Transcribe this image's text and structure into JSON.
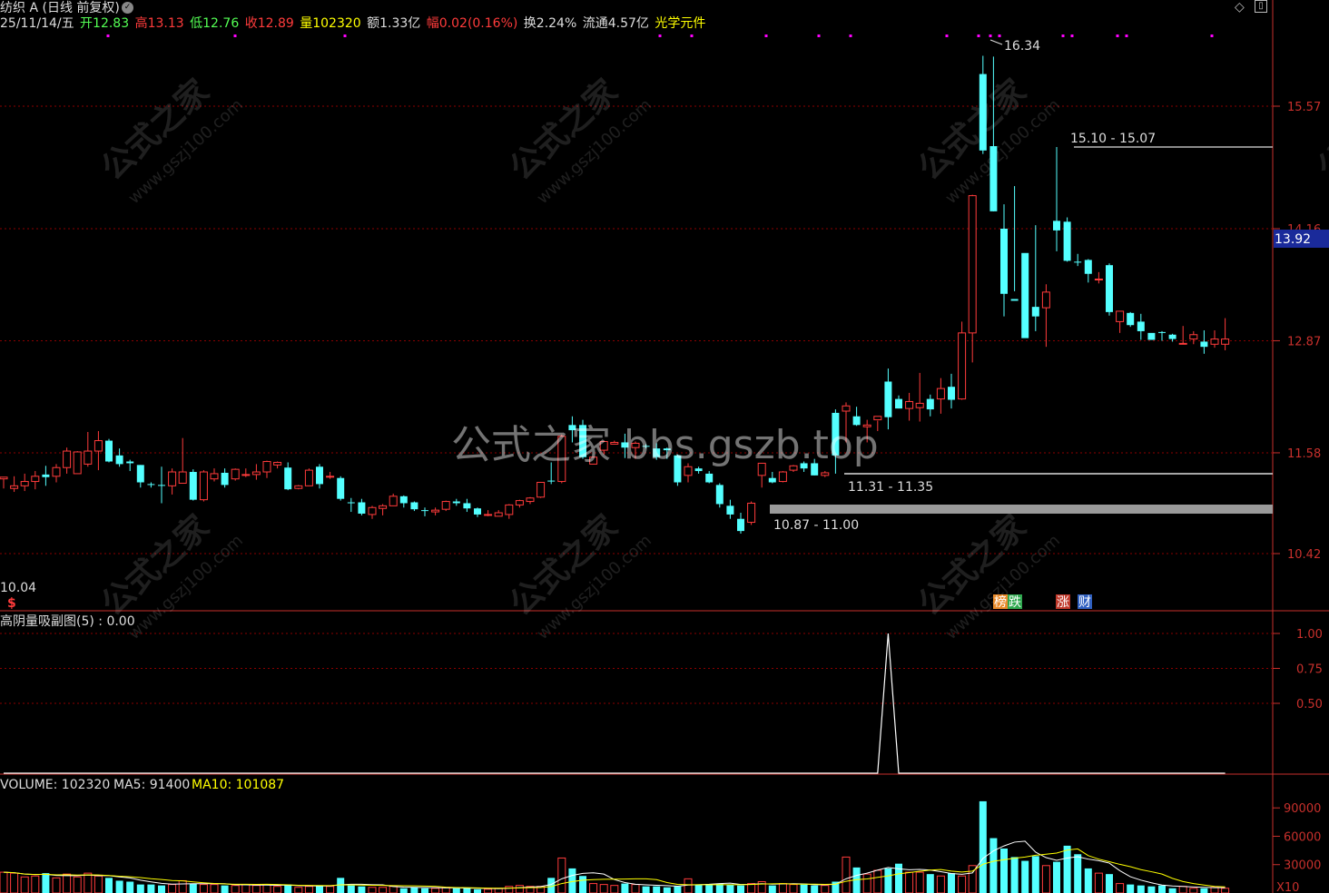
{
  "header": {
    "title": "纺织 A (日线 前复权)",
    "date": "25/11/14/五",
    "open_label": "开",
    "open": "12.83",
    "high_label": "高",
    "high": "13.13",
    "low_label": "低",
    "low": "12.76",
    "close_label": "收",
    "close": "12.89",
    "vol_label": "量",
    "vol": "102320",
    "amount": "额1.33亿",
    "change_label": "幅",
    "change": "0.02(0.16%)",
    "turnover": "换2.24%",
    "float_cap": "流通4.57亿",
    "concept": "光学元件"
  },
  "watermark": {
    "main": "公式之家 bbs.gszb.top",
    "tile_cn": "公式之家",
    "tile_url": "www.gszj100.com"
  },
  "colors": {
    "up": "#ff3b3b",
    "down": "#54ffff",
    "grid": "#8b0000",
    "axis": "#c8302c",
    "white": "#ffffff",
    "yellow": "#ffff00",
    "magenta": "#ff00ff"
  },
  "chart_data": [
    {
      "type": "candlestick",
      "name": "main",
      "price_axis_ticks": [
        "15.57",
        "14.16",
        "12.87",
        "11.58",
        "10.42"
      ],
      "current_price_tag": "13.92",
      "low_label": "10.04",
      "peak_label": "16.34",
      "annotations": [
        {
          "text": "15.10 - 15.07"
        },
        {
          "text": "11.31 - 11.35"
        },
        {
          "text": "10.87 - 11.00"
        }
      ],
      "badges": [
        {
          "text": "榜",
          "color": "#e88a2a"
        },
        {
          "text": "跌",
          "color": "#2fa84f"
        },
        {
          "text": "涨",
          "color": "#c0392b"
        },
        {
          "text": "财",
          "color": "#3060c0"
        }
      ],
      "marker": "$",
      "signal_dots": 19,
      "ohlc": [
        [
          11.28,
          11.3,
          11.17,
          11.3
        ],
        [
          11.17,
          11.31,
          11.13,
          11.2
        ],
        [
          11.2,
          11.34,
          11.14,
          11.25
        ],
        [
          11.25,
          11.37,
          11.16,
          11.31
        ],
        [
          11.33,
          11.43,
          11.2,
          11.3
        ],
        [
          11.31,
          11.45,
          11.24,
          11.41
        ],
        [
          11.41,
          11.64,
          11.34,
          11.6
        ],
        [
          11.34,
          11.6,
          11.34,
          11.59
        ],
        [
          11.45,
          11.82,
          11.42,
          11.6
        ],
        [
          11.6,
          11.83,
          11.38,
          11.72
        ],
        [
          11.72,
          11.74,
          11.47,
          11.48
        ],
        [
          11.55,
          11.63,
          11.42,
          11.45
        ],
        [
          11.48,
          11.5,
          11.37,
          11.46
        ],
        [
          11.44,
          11.44,
          11.18,
          11.24
        ],
        [
          11.22,
          11.24,
          11.18,
          11.21
        ],
        [
          11.21,
          11.42,
          11.0,
          11.2
        ],
        [
          11.2,
          11.4,
          11.1,
          11.36
        ],
        [
          11.23,
          11.75,
          11.25,
          11.36
        ],
        [
          11.36,
          11.39,
          11.03,
          11.04
        ],
        [
          11.04,
          11.38,
          11.02,
          11.36
        ],
        [
          11.28,
          11.4,
          11.25,
          11.34
        ],
        [
          11.35,
          11.4,
          11.18,
          11.21
        ],
        [
          11.28,
          11.4,
          11.26,
          11.39
        ],
        [
          11.32,
          11.4,
          11.3,
          11.33
        ],
        [
          11.33,
          11.45,
          11.27,
          11.36
        ],
        [
          11.36,
          11.49,
          11.29,
          11.48
        ],
        [
          11.44,
          11.48,
          11.4,
          11.47
        ],
        [
          11.41,
          11.47,
          11.15,
          11.16
        ],
        [
          11.17,
          11.21,
          11.16,
          11.2
        ],
        [
          11.2,
          11.4,
          11.2,
          11.38
        ],
        [
          11.42,
          11.45,
          11.17,
          11.22
        ],
        [
          11.3,
          11.36,
          11.28,
          11.31
        ],
        [
          11.29,
          11.31,
          11.03,
          11.05
        ],
        [
          11.01,
          11.06,
          10.9,
          11.0
        ],
        [
          11.01,
          11.05,
          10.86,
          10.88
        ],
        [
          10.87,
          10.97,
          10.82,
          10.95
        ],
        [
          10.94,
          10.99,
          10.86,
          10.97
        ],
        [
          10.97,
          11.11,
          10.98,
          11.08
        ],
        [
          11.08,
          11.09,
          10.95,
          11.0
        ],
        [
          11.01,
          11.02,
          10.91,
          10.93
        ],
        [
          10.92,
          10.95,
          10.85,
          10.91
        ],
        [
          10.9,
          10.95,
          10.86,
          10.92
        ],
        [
          10.93,
          11.03,
          10.91,
          11.02
        ],
        [
          11.02,
          11.05,
          10.97,
          11.0
        ],
        [
          11.0,
          11.05,
          10.9,
          10.94
        ],
        [
          10.94,
          10.95,
          10.84,
          10.87
        ],
        [
          10.87,
          10.92,
          10.85,
          10.87
        ],
        [
          10.85,
          10.92,
          10.86,
          10.89
        ],
        [
          10.87,
          10.99,
          10.82,
          10.98
        ],
        [
          10.98,
          11.04,
          10.95,
          11.03
        ],
        [
          11.02,
          11.07,
          10.99,
          11.06
        ],
        [
          11.07,
          11.22,
          11.06,
          11.24
        ],
        [
          11.26,
          11.47,
          11.22,
          11.25
        ],
        [
          11.25,
          11.79,
          11.23,
          11.77
        ],
        [
          11.9,
          12.0,
          11.7,
          11.84
        ],
        [
          11.9,
          11.96,
          11.51,
          11.53
        ],
        [
          11.45,
          11.53,
          11.45,
          11.53
        ],
        [
          11.61,
          11.72,
          11.56,
          11.71
        ],
        [
          11.68,
          11.72,
          11.68,
          11.7
        ],
        [
          11.7,
          11.8,
          11.52,
          11.64
        ],
        [
          11.64,
          11.71,
          11.51,
          11.69
        ],
        [
          11.66,
          11.68,
          11.63,
          11.65
        ],
        [
          11.63,
          11.69,
          11.5,
          11.53
        ],
        [
          11.63,
          11.64,
          11.51,
          11.61
        ],
        [
          11.55,
          11.56,
          11.2,
          11.24
        ],
        [
          11.32,
          11.46,
          11.24,
          11.42
        ],
        [
          11.4,
          11.42,
          11.34,
          11.37
        ],
        [
          11.34,
          11.37,
          11.23,
          11.24
        ],
        [
          11.21,
          11.23,
          10.95,
          10.99
        ],
        [
          10.97,
          11.04,
          10.82,
          10.87
        ],
        [
          10.82,
          10.89,
          10.65,
          10.68
        ],
        [
          10.78,
          11.02,
          10.75,
          11.0
        ],
        [
          11.32,
          11.46,
          11.18,
          11.46
        ],
        [
          11.29,
          11.36,
          11.23,
          11.24
        ],
        [
          11.25,
          11.37,
          11.24,
          11.36
        ],
        [
          11.38,
          11.44,
          11.36,
          11.43
        ],
        [
          11.46,
          11.48,
          11.36,
          11.4
        ],
        [
          11.46,
          11.51,
          11.32,
          11.32
        ],
        [
          11.32,
          11.37,
          11.3,
          11.35
        ],
        [
          12.04,
          12.08,
          11.34,
          11.55
        ],
        [
          12.06,
          12.16,
          11.7,
          12.12
        ],
        [
          12.0,
          12.11,
          11.89,
          11.9
        ],
        [
          11.88,
          11.96,
          11.7,
          11.9
        ],
        [
          11.96,
          11.95,
          11.83,
          12.0
        ],
        [
          12.4,
          12.55,
          11.85,
          11.99
        ],
        [
          12.2,
          12.24,
          12.09,
          12.09
        ],
        [
          12.09,
          12.27,
          11.95,
          12.17
        ],
        [
          12.1,
          12.5,
          11.94,
          12.15
        ],
        [
          12.2,
          12.25,
          12.0,
          12.08
        ],
        [
          12.2,
          12.44,
          12.03,
          12.32
        ],
        [
          12.34,
          12.49,
          12.09,
          12.19
        ],
        [
          12.2,
          13.09,
          12.19,
          12.96
        ],
        [
          12.96,
          14.55,
          12.62,
          14.54
        ],
        [
          15.94,
          16.15,
          15.02,
          15.06
        ],
        [
          15.11,
          16.14,
          14.36,
          14.36
        ],
        [
          14.16,
          14.44,
          13.15,
          13.41
        ],
        [
          13.35,
          14.65,
          13.44,
          13.33
        ],
        [
          13.88,
          13.87,
          12.98,
          12.9
        ],
        [
          13.26,
          14.2,
          12.98,
          13.15
        ],
        [
          13.25,
          13.52,
          12.8,
          13.43
        ],
        [
          14.25,
          15.1,
          13.9,
          14.14
        ],
        [
          14.24,
          14.29,
          13.78,
          13.79
        ],
        [
          13.78,
          13.87,
          13.73,
          13.77
        ],
        [
          13.8,
          13.81,
          13.54,
          13.64
        ],
        [
          13.58,
          13.66,
          13.53,
          13.58
        ],
        [
          13.74,
          13.76,
          13.16,
          13.2
        ],
        [
          13.09,
          13.16,
          12.96,
          13.21
        ],
        [
          13.19,
          13.2,
          13.03,
          13.05
        ],
        [
          13.09,
          13.18,
          12.88,
          12.98
        ],
        [
          12.96,
          12.99,
          12.99,
          12.88
        ],
        [
          12.97,
          12.98,
          12.87,
          12.96
        ],
        [
          12.94,
          12.95,
          12.86,
          12.89
        ],
        [
          12.84,
          13.04,
          12.84,
          12.84
        ],
        [
          12.89,
          12.98,
          12.83,
          12.94
        ],
        [
          12.86,
          12.99,
          12.72,
          12.8
        ],
        [
          12.83,
          12.99,
          12.79,
          12.89
        ],
        [
          12.83,
          13.13,
          12.76,
          12.89
        ]
      ]
    },
    {
      "type": "line",
      "name": "sub",
      "title": "高阴量吸副图(5) : 0.00",
      "ylim": [
        0,
        1
      ],
      "ticks": [
        "1.00",
        "0.75",
        "0.50"
      ],
      "spike_index": 84,
      "values_note": "all zero except spike of 1.00"
    },
    {
      "type": "bar",
      "name": "volume",
      "title_vol": "VOLUME: 102320",
      "title_ma5": "MA5: 91400",
      "title_ma10": "MA10: 101087",
      "ticks": [
        "90000",
        "60000",
        "30000"
      ],
      "corner_label": "X10",
      "volumes": [
        22000,
        21000,
        17000,
        18000,
        21000,
        16000,
        20000,
        17000,
        21000,
        18000,
        16000,
        13000,
        12000,
        9000,
        9000,
        8000,
        9000,
        13000,
        10000,
        9000,
        9000,
        8000,
        8000,
        9000,
        8000,
        9000,
        7000,
        9000,
        6000,
        7000,
        8000,
        7000,
        16000,
        8000,
        7000,
        6000,
        6000,
        7000,
        5000,
        6000,
        5000,
        5000,
        6000,
        5000,
        5000,
        4000,
        4000,
        5000,
        7000,
        8000,
        7000,
        7000,
        16000,
        37000,
        26000,
        18000,
        10000,
        9000,
        8000,
        10000,
        9000,
        7000,
        7000,
        6000,
        7000,
        15000,
        9000,
        9000,
        10000,
        9000,
        8000,
        10000,
        12000,
        8000,
        10000,
        9000,
        9000,
        8000,
        8000,
        12000,
        38000,
        27000,
        20000,
        24000,
        26000,
        31000,
        22000,
        22000,
        20000,
        18000,
        21000,
        18000,
        29000,
        97000,
        58000,
        47000,
        38000,
        34000,
        39000,
        29000,
        33000,
        50000,
        41000,
        26000,
        21000,
        20000,
        10000,
        9000,
        8000,
        7000,
        8000,
        5000,
        7000,
        5000,
        5000,
        6000,
        5000,
        3000
      ]
    }
  ]
}
